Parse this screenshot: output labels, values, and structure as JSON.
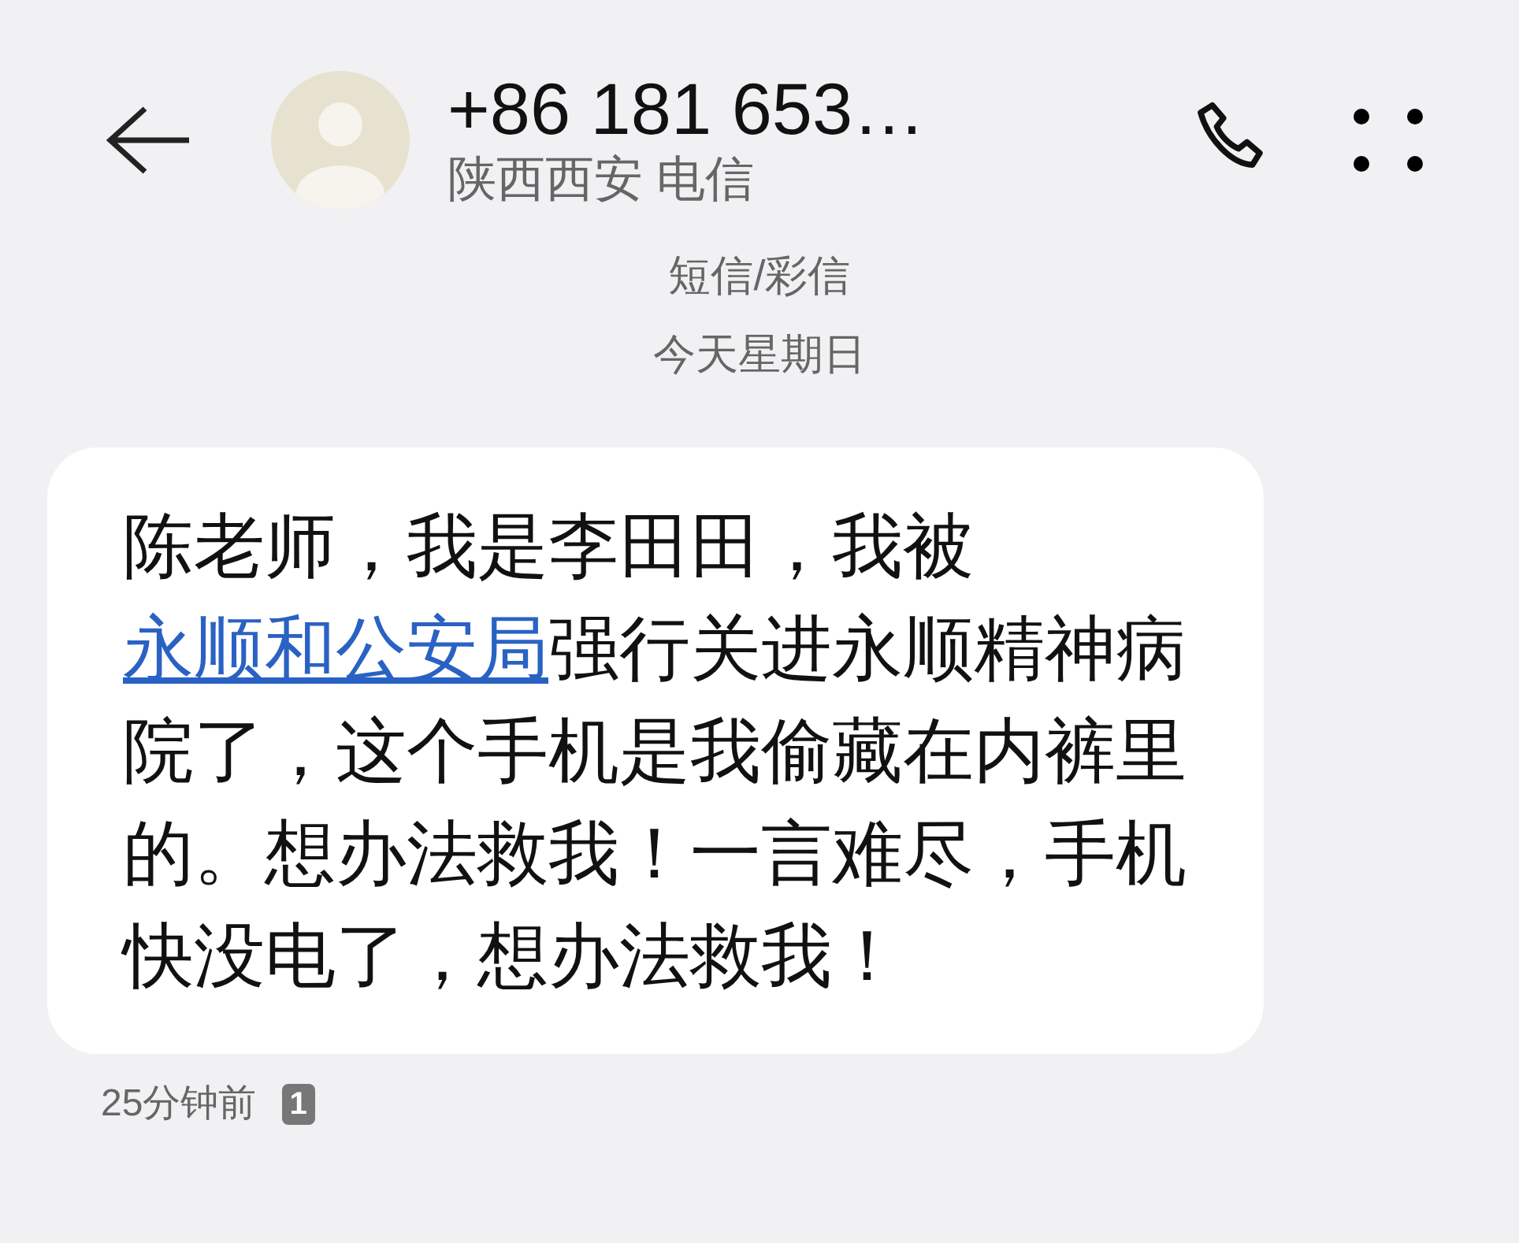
{
  "header": {
    "title": "+86 181 653…",
    "subtitle": "陕西西安 电信"
  },
  "conversation": {
    "type_label": "短信/彩信",
    "date": "今天星期日"
  },
  "messages": [
    {
      "segments": [
        {
          "kind": "text",
          "text": "陈老师，我是李田田，我被"
        },
        {
          "kind": "link",
          "text": "永顺和公安局"
        },
        {
          "kind": "text",
          "text": "强行关进永顺精神病院了，这个手机是我偷藏在内裤里的。想办法救我！一言难尽，手机快没电了，想办法救我！"
        }
      ],
      "time": "25分钟前",
      "sim": "1"
    }
  ]
}
